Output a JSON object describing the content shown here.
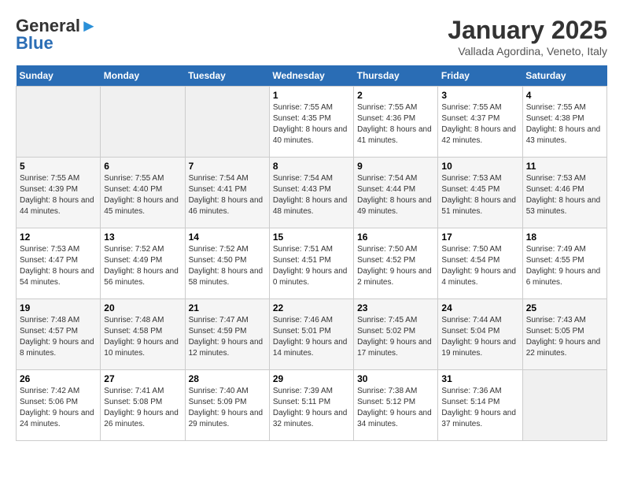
{
  "header": {
    "logo_general": "General",
    "logo_blue": "Blue",
    "month": "January 2025",
    "location": "Vallada Agordina, Veneto, Italy"
  },
  "days_of_week": [
    "Sunday",
    "Monday",
    "Tuesday",
    "Wednesday",
    "Thursday",
    "Friday",
    "Saturday"
  ],
  "weeks": [
    [
      {
        "day": "",
        "empty": true
      },
      {
        "day": "",
        "empty": true
      },
      {
        "day": "",
        "empty": true
      },
      {
        "day": "1",
        "sunrise": "7:55 AM",
        "sunset": "4:35 PM",
        "daylight": "8 hours and 40 minutes."
      },
      {
        "day": "2",
        "sunrise": "7:55 AM",
        "sunset": "4:36 PM",
        "daylight": "8 hours and 41 minutes."
      },
      {
        "day": "3",
        "sunrise": "7:55 AM",
        "sunset": "4:37 PM",
        "daylight": "8 hours and 42 minutes."
      },
      {
        "day": "4",
        "sunrise": "7:55 AM",
        "sunset": "4:38 PM",
        "daylight": "8 hours and 43 minutes."
      }
    ],
    [
      {
        "day": "5",
        "sunrise": "7:55 AM",
        "sunset": "4:39 PM",
        "daylight": "8 hours and 44 minutes."
      },
      {
        "day": "6",
        "sunrise": "7:55 AM",
        "sunset": "4:40 PM",
        "daylight": "8 hours and 45 minutes."
      },
      {
        "day": "7",
        "sunrise": "7:54 AM",
        "sunset": "4:41 PM",
        "daylight": "8 hours and 46 minutes."
      },
      {
        "day": "8",
        "sunrise": "7:54 AM",
        "sunset": "4:43 PM",
        "daylight": "8 hours and 48 minutes."
      },
      {
        "day": "9",
        "sunrise": "7:54 AM",
        "sunset": "4:44 PM",
        "daylight": "8 hours and 49 minutes."
      },
      {
        "day": "10",
        "sunrise": "7:53 AM",
        "sunset": "4:45 PM",
        "daylight": "8 hours and 51 minutes."
      },
      {
        "day": "11",
        "sunrise": "7:53 AM",
        "sunset": "4:46 PM",
        "daylight": "8 hours and 53 minutes."
      }
    ],
    [
      {
        "day": "12",
        "sunrise": "7:53 AM",
        "sunset": "4:47 PM",
        "daylight": "8 hours and 54 minutes."
      },
      {
        "day": "13",
        "sunrise": "7:52 AM",
        "sunset": "4:49 PM",
        "daylight": "8 hours and 56 minutes."
      },
      {
        "day": "14",
        "sunrise": "7:52 AM",
        "sunset": "4:50 PM",
        "daylight": "8 hours and 58 minutes."
      },
      {
        "day": "15",
        "sunrise": "7:51 AM",
        "sunset": "4:51 PM",
        "daylight": "9 hours and 0 minutes."
      },
      {
        "day": "16",
        "sunrise": "7:50 AM",
        "sunset": "4:52 PM",
        "daylight": "9 hours and 2 minutes."
      },
      {
        "day": "17",
        "sunrise": "7:50 AM",
        "sunset": "4:54 PM",
        "daylight": "9 hours and 4 minutes."
      },
      {
        "day": "18",
        "sunrise": "7:49 AM",
        "sunset": "4:55 PM",
        "daylight": "9 hours and 6 minutes."
      }
    ],
    [
      {
        "day": "19",
        "sunrise": "7:48 AM",
        "sunset": "4:57 PM",
        "daylight": "9 hours and 8 minutes."
      },
      {
        "day": "20",
        "sunrise": "7:48 AM",
        "sunset": "4:58 PM",
        "daylight": "9 hours and 10 minutes."
      },
      {
        "day": "21",
        "sunrise": "7:47 AM",
        "sunset": "4:59 PM",
        "daylight": "9 hours and 12 minutes."
      },
      {
        "day": "22",
        "sunrise": "7:46 AM",
        "sunset": "5:01 PM",
        "daylight": "9 hours and 14 minutes."
      },
      {
        "day": "23",
        "sunrise": "7:45 AM",
        "sunset": "5:02 PM",
        "daylight": "9 hours and 17 minutes."
      },
      {
        "day": "24",
        "sunrise": "7:44 AM",
        "sunset": "5:04 PM",
        "daylight": "9 hours and 19 minutes."
      },
      {
        "day": "25",
        "sunrise": "7:43 AM",
        "sunset": "5:05 PM",
        "daylight": "9 hours and 22 minutes."
      }
    ],
    [
      {
        "day": "26",
        "sunrise": "7:42 AM",
        "sunset": "5:06 PM",
        "daylight": "9 hours and 24 minutes."
      },
      {
        "day": "27",
        "sunrise": "7:41 AM",
        "sunset": "5:08 PM",
        "daylight": "9 hours and 26 minutes."
      },
      {
        "day": "28",
        "sunrise": "7:40 AM",
        "sunset": "5:09 PM",
        "daylight": "9 hours and 29 minutes."
      },
      {
        "day": "29",
        "sunrise": "7:39 AM",
        "sunset": "5:11 PM",
        "daylight": "9 hours and 32 minutes."
      },
      {
        "day": "30",
        "sunrise": "7:38 AM",
        "sunset": "5:12 PM",
        "daylight": "9 hours and 34 minutes."
      },
      {
        "day": "31",
        "sunrise": "7:36 AM",
        "sunset": "5:14 PM",
        "daylight": "9 hours and 37 minutes."
      },
      {
        "day": "",
        "empty": true
      }
    ]
  ],
  "labels": {
    "sunrise": "Sunrise: ",
    "sunset": "Sunset: ",
    "daylight": "Daylight: "
  }
}
